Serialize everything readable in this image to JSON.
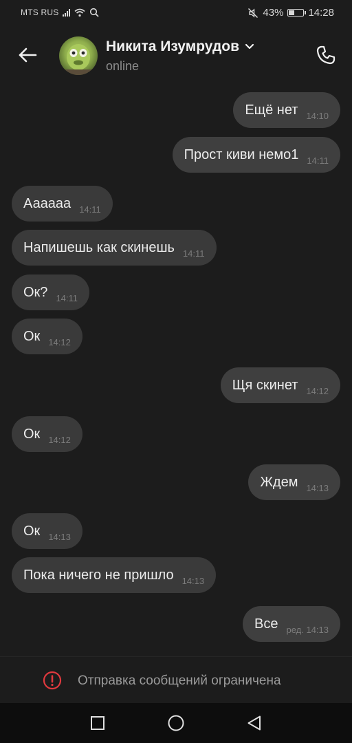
{
  "status_bar": {
    "carrier": "MTS RUS",
    "battery_percent": "43%",
    "battery_level": 0.43,
    "time": "14:28",
    "icons": [
      "signal-icon",
      "wifi-icon",
      "search-icon",
      "mute-icon",
      "battery-icon"
    ]
  },
  "header": {
    "contact_name": "Никита Изумрудов",
    "contact_status": "online",
    "icons": [
      "back-arrow-icon",
      "chevron-down-icon",
      "phone-icon"
    ]
  },
  "messages": [
    {
      "direction": "out",
      "text": "Ещё нет",
      "time": "14:10"
    },
    {
      "direction": "out",
      "text": "Прост киви немо1",
      "time": "14:11"
    },
    {
      "direction": "in",
      "text": "Аааааа",
      "time": "14:11"
    },
    {
      "direction": "in",
      "text": "Напишешь как скинешь",
      "time": "14:11"
    },
    {
      "direction": "in",
      "text": "Ок?",
      "time": "14:11"
    },
    {
      "direction": "in",
      "text": "Ок",
      "time": "14:12"
    },
    {
      "direction": "out",
      "text": "Щя скинет",
      "time": "14:12"
    },
    {
      "direction": "in",
      "text": "Ок",
      "time": "14:12"
    },
    {
      "direction": "out",
      "text": "Ждем",
      "time": "14:13"
    },
    {
      "direction": "in",
      "text": "Ок",
      "time": "14:13"
    },
    {
      "direction": "in",
      "text": "Пока ничего не пришло",
      "time": "14:13"
    },
    {
      "direction": "out",
      "text": "Все",
      "time": "ред. 14:13"
    }
  ],
  "restriction": {
    "text": "Отправка сообщений ограничена",
    "icon": "alert-circle-icon",
    "color": "#e0393e"
  },
  "nav_bar": {
    "icons": [
      "recent-apps-icon",
      "home-icon",
      "back-icon"
    ]
  }
}
